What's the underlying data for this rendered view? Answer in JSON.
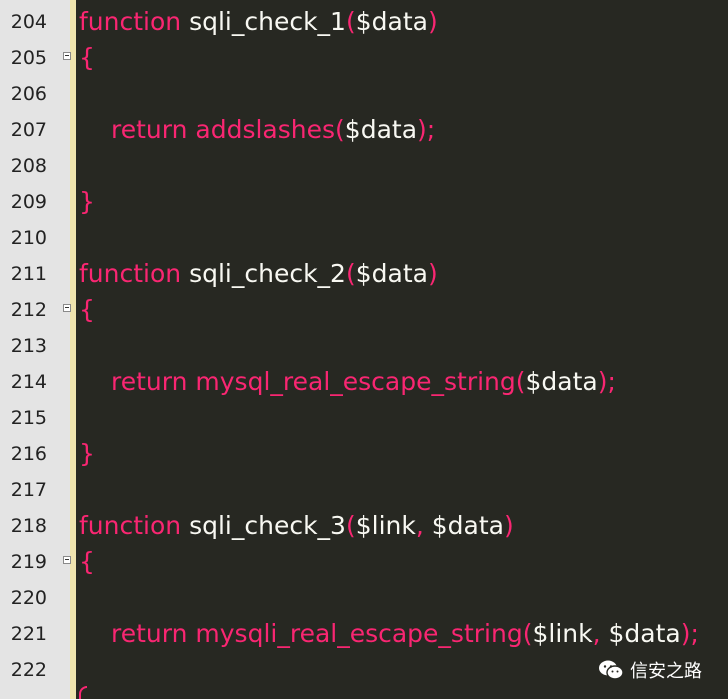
{
  "lines": {
    "l204": {
      "num": "204",
      "kw": "function",
      "name": "sqli_check_1",
      "open": "(",
      "arg": "$data",
      "close": ")"
    },
    "l205": {
      "num": "205",
      "brace": "{"
    },
    "l206": {
      "num": "206"
    },
    "l207": {
      "num": "207",
      "ret": "return",
      "call": "addslashes",
      "open": "(",
      "arg": "$data",
      "close": ");"
    },
    "l208": {
      "num": "208"
    },
    "l209": {
      "num": "209",
      "brace": "}"
    },
    "l210": {
      "num": "210"
    },
    "l211": {
      "num": "211",
      "kw": "function",
      "name": "sqli_check_2",
      "open": "(",
      "arg": "$data",
      "close": ")"
    },
    "l212": {
      "num": "212",
      "brace": "{"
    },
    "l213": {
      "num": "213"
    },
    "l214": {
      "num": "214",
      "ret": "return",
      "call": "mysql_real_escape_string",
      "open": "(",
      "arg": "$data",
      "close": ");"
    },
    "l215": {
      "num": "215"
    },
    "l216": {
      "num": "216",
      "brace": "}"
    },
    "l217": {
      "num": "217"
    },
    "l218": {
      "num": "218",
      "kw": "function",
      "name": "sqli_check_3",
      "open": "(",
      "arg1": "$link",
      "comma": ", ",
      "arg2": "$data",
      "close": ")"
    },
    "l219": {
      "num": "219",
      "brace": "{"
    },
    "l220": {
      "num": "220"
    },
    "l221": {
      "num": "221",
      "ret": "return",
      "call": "mysqli_real_escape_string",
      "open": "(",
      "arg1": "$link",
      "comma": ", ",
      "arg2": "$data",
      "close": ");"
    },
    "l222": {
      "num": "222"
    }
  },
  "watermark": {
    "icon": "wechat-icon",
    "label": "信安之路"
  },
  "colors": {
    "background": "#272822",
    "keyword": "#f92672",
    "text": "#f8f8f2",
    "gutter": "#e4e4e4",
    "gutter_divider": "#efe4ae"
  }
}
